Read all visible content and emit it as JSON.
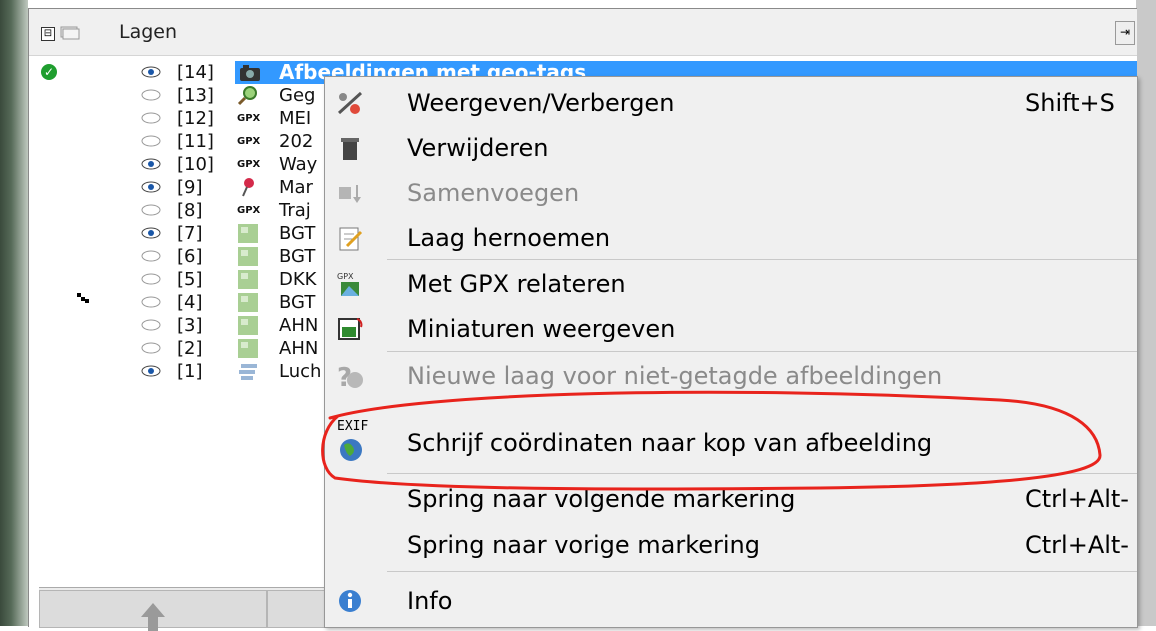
{
  "panel": {
    "title": "Lagen",
    "collapse_glyph": "⊟",
    "pin_glyph": "⇥"
  },
  "layers": [
    {
      "index": "[14]",
      "name": "Afbeeldingen met geo-tags",
      "visible": true,
      "icon": "camera-icon",
      "selected": true
    },
    {
      "index": "[13]",
      "name": "Geg",
      "visible": false,
      "icon": "magnifier-icon"
    },
    {
      "index": "[12]",
      "name": "MEI",
      "visible": false,
      "icon": "gpx-icon"
    },
    {
      "index": "[11]",
      "name": "202",
      "visible": false,
      "icon": "gpx-icon"
    },
    {
      "index": "[10]",
      "name": "Way",
      "visible": true,
      "icon": "gpx-icon"
    },
    {
      "index": "[9]",
      "name": "Mar",
      "visible": true,
      "icon": "pushpin-icon"
    },
    {
      "index": "[8]",
      "name": "Traj",
      "visible": false,
      "icon": "gpx-icon"
    },
    {
      "index": "[7]",
      "name": "BGT",
      "visible": true,
      "icon": "imagery-icon"
    },
    {
      "index": "[6]",
      "name": "BGT",
      "visible": false,
      "icon": "imagery-icon"
    },
    {
      "index": "[5]",
      "name": "DKK",
      "visible": false,
      "icon": "imagery-icon"
    },
    {
      "index": "[4]",
      "name": "BGT",
      "visible": false,
      "icon": "imagery-icon"
    },
    {
      "index": "[3]",
      "name": "AHN",
      "visible": false,
      "icon": "imagery-icon"
    },
    {
      "index": "[2]",
      "name": "AHN",
      "visible": false,
      "icon": "imagery-icon"
    },
    {
      "index": "[1]",
      "name": "Luch",
      "visible": true,
      "icon": "aerial-icon"
    }
  ],
  "gpx_label": "GPX",
  "menu": {
    "items": [
      {
        "label": "Weergeven/Verbergen",
        "shortcut": "Shift+S",
        "icon": "show-hide-icon"
      },
      {
        "label": "Verwijderen",
        "shortcut": "",
        "icon": "trash-icon"
      },
      {
        "label": "Samenvoegen",
        "shortcut": "",
        "icon": "merge-icon",
        "disabled": true
      },
      {
        "label": "Laag hernoemen",
        "shortcut": "",
        "icon": "rename-icon"
      },
      {
        "label": "Met GPX relateren",
        "shortcut": "",
        "icon": "gpx-correlate-icon"
      },
      {
        "label": "Miniaturen weergeven",
        "shortcut": "",
        "icon": "thumbnails-icon"
      },
      {
        "label": "Nieuwe laag voor niet-getagde afbeeldingen",
        "shortcut": "",
        "icon": "untagged-icon",
        "disabled": true
      },
      {
        "label": "Schrijf coördinaten naar kop van afbeelding",
        "shortcut": "",
        "icon": "exif-globe-icon"
      },
      {
        "label": "Spring naar volgende markering",
        "shortcut": "Ctrl+Alt-",
        "icon": ""
      },
      {
        "label": "Spring naar vorige markering",
        "shortcut": "Ctrl+Alt-",
        "icon": ""
      },
      {
        "label": "Info",
        "shortcut": "",
        "icon": "info-icon"
      }
    ],
    "exif_text": "EXIF"
  },
  "colors": {
    "selection": "#3399ff",
    "annotation": "#e8231c",
    "menu_bg": "#f0f0f0"
  }
}
